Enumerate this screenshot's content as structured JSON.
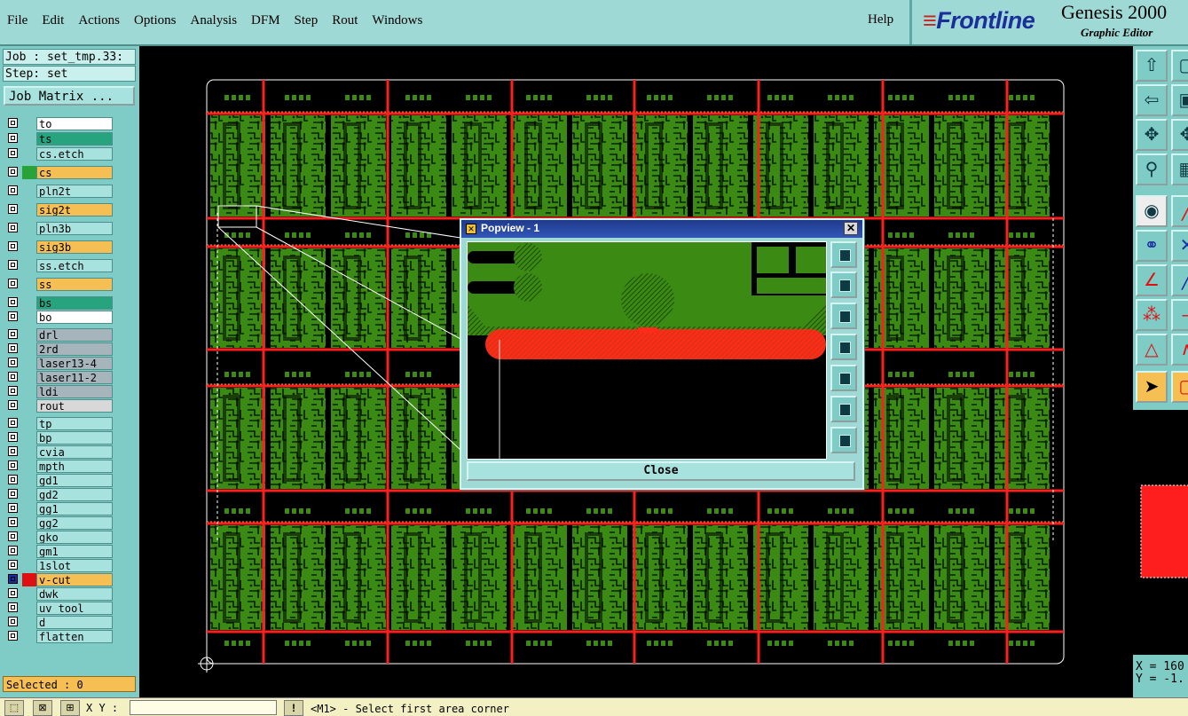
{
  "menubar": {
    "items": [
      {
        "label": "File"
      },
      {
        "label": "Edit"
      },
      {
        "label": "Actions"
      },
      {
        "label": "Options"
      },
      {
        "label": "Analysis"
      },
      {
        "label": "DFM"
      },
      {
        "label": "Step"
      },
      {
        "label": "Rout"
      },
      {
        "label": "Windows"
      }
    ],
    "help": "Help"
  },
  "brand": {
    "logo": "Frontline",
    "title": "Genesis 2000",
    "subtitle": "Graphic Editor"
  },
  "left_panel": {
    "job": "Job : set_tmp.33:",
    "step": "Step: set",
    "job_matrix_button": "Job Matrix ...",
    "layers": [
      {
        "name": "to",
        "bg": "#ffffff",
        "swatch": ""
      },
      {
        "name": "ts",
        "bg": "#27a37e",
        "swatch": ""
      },
      {
        "name": "cs.etch",
        "bg": "#a8e2de",
        "swatch": ""
      },
      {
        "name": "cs",
        "bg": "#f5bf54",
        "swatch": "#27a337"
      },
      {
        "name": "pln2t",
        "bg": "#a8e2de",
        "swatch": ""
      },
      {
        "name": "sig2t",
        "bg": "#f5bf54",
        "swatch": ""
      },
      {
        "name": "pln3b",
        "bg": "#a8e2de",
        "swatch": ""
      },
      {
        "name": "sig3b",
        "bg": "#f5bf54",
        "swatch": ""
      },
      {
        "name": "ss.etch",
        "bg": "#a8e2de",
        "swatch": ""
      },
      {
        "name": "ss",
        "bg": "#f5bf54",
        "swatch": ""
      },
      {
        "name": "bs",
        "bg": "#27a37e",
        "swatch": ""
      },
      {
        "name": "bo",
        "bg": "#ffffff",
        "swatch": ""
      },
      {
        "name": "drl",
        "bg": "#a6b4bc",
        "swatch": ""
      },
      {
        "name": "2rd",
        "bg": "#a6b4bc",
        "swatch": ""
      },
      {
        "name": "laser13-4",
        "bg": "#a6b4bc",
        "swatch": ""
      },
      {
        "name": "laser11-2",
        "bg": "#a6b4bc",
        "swatch": ""
      },
      {
        "name": "ldi",
        "bg": "#a6b4bc",
        "swatch": ""
      },
      {
        "name": "rout",
        "bg": "#d8d8d8",
        "swatch": ""
      },
      {
        "name": "tp",
        "bg": "#a8e2de",
        "swatch": ""
      },
      {
        "name": "bp",
        "bg": "#a8e2de",
        "swatch": ""
      },
      {
        "name": "cvia",
        "bg": "#a8e2de",
        "swatch": ""
      },
      {
        "name": "mpth",
        "bg": "#a8e2de",
        "swatch": ""
      },
      {
        "name": "gd1",
        "bg": "#a8e2de",
        "swatch": ""
      },
      {
        "name": "gd2",
        "bg": "#a8e2de",
        "swatch": ""
      },
      {
        "name": "gg1",
        "bg": "#a8e2de",
        "swatch": ""
      },
      {
        "name": "gg2",
        "bg": "#a8e2de",
        "swatch": ""
      },
      {
        "name": "gko",
        "bg": "#a8e2de",
        "swatch": ""
      },
      {
        "name": "gm1",
        "bg": "#a8e2de",
        "swatch": ""
      },
      {
        "name": "1slot",
        "bg": "#a8e2de",
        "swatch": ""
      },
      {
        "name": "v-cut",
        "bg": "#f5bf54",
        "swatch": "#e01010"
      },
      {
        "name": "dwk",
        "bg": "#a8e2de",
        "swatch": ""
      },
      {
        "name": "uv_tool",
        "bg": "#a8e2de",
        "swatch": ""
      },
      {
        "name": "d",
        "bg": "#a8e2de",
        "swatch": ""
      },
      {
        "name": "flatten",
        "bg": "#a8e2de",
        "swatch": ""
      }
    ],
    "selected": "Selected : 0"
  },
  "popview": {
    "title": "Popview - 1",
    "close_button": "Close",
    "close_x": "✕",
    "tools": [
      "zoom-fit-icon",
      "pan-up-icon",
      "pan-down-icon",
      "pan-left-icon",
      "pan-right-icon",
      "zoom-in-icon",
      "zoom-out-icon"
    ]
  },
  "right_panel": {
    "coords": "X = 160\nY = -1."
  },
  "statusbar": {
    "xy_label": "X Y :",
    "xy_value": "",
    "warn": "!",
    "message": "<M1> - Select first area corner"
  },
  "colors": {
    "panel": "#7fccc7",
    "copper": "#3a8a14",
    "vcut": "#ff1e1e",
    "board_outline": "#ffffff"
  }
}
